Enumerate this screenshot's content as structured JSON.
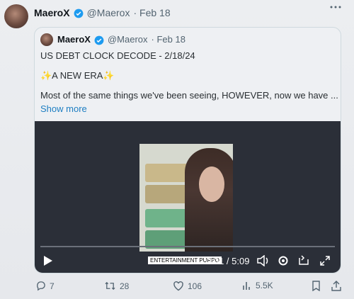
{
  "tweet": {
    "author_name": "MaeroX",
    "handle": "@Maerox",
    "date": "· Feb 18",
    "more_icon": "more-icon"
  },
  "quote": {
    "author_name": "MaeroX",
    "handle": "@Maerox",
    "date": "· Feb 18",
    "line1": "US DEBT CLOCK DECODE - 2/18/24",
    "line2": "✨A NEW ERA✨",
    "line3": "Most of the same things we've been seeing, HOWEVER, now we have ...",
    "show_more": "Show more"
  },
  "video": {
    "caption": "ENTERTAINMENT PURPO",
    "time": "0:01 / 5:09",
    "progress": 0.0
  },
  "actions": {
    "replies": "7",
    "retweets": "28",
    "likes": "106",
    "views": "5.5K"
  },
  "colors": {
    "link": "#1d7ec2",
    "verified": "#1d9bf0",
    "video_bg": "#2b2f38"
  }
}
